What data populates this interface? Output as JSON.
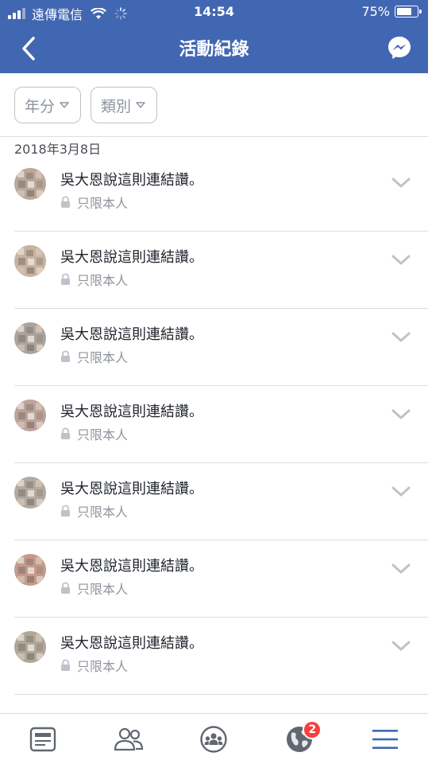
{
  "status_bar": {
    "carrier": "遠傳電信",
    "time": "14:54",
    "battery": "75%",
    "battery_level": 0.75
  },
  "header": {
    "title": "活動紀錄",
    "back_icon": "chevron-left-icon",
    "messenger_icon": "messenger-icon"
  },
  "filters": [
    {
      "label": "年分"
    },
    {
      "label": "類別"
    }
  ],
  "date_header": "2018年3月8日",
  "activities": [
    {
      "text": "吳大恩說這則連結讚。",
      "privacy": "只限本人",
      "avatar_color": "#b9a89b"
    },
    {
      "text": "吳大恩說這則連結讚。",
      "privacy": "只限本人",
      "avatar_color": "#c7b3a2"
    },
    {
      "text": "吳大恩說這則連結讚。",
      "privacy": "只限本人",
      "avatar_color": "#a9a4a0"
    },
    {
      "text": "吳大恩說這則連結讚。",
      "privacy": "只限本人",
      "avatar_color": "#bba39c"
    },
    {
      "text": "吳大恩說這則連結讚。",
      "privacy": "只限本人",
      "avatar_color": "#b0aaa0"
    },
    {
      "text": "吳大恩說這則連結讚。",
      "privacy": "只限本人",
      "avatar_color": "#c49a8c"
    },
    {
      "text": "吳大恩說這則連結讚。",
      "privacy": "只限本人",
      "avatar_color": "#aca99a"
    }
  ],
  "tabbar": {
    "notifications_badge": "2",
    "active_color": "#4267b2",
    "inactive_color": "#606770"
  },
  "colors": {
    "brand_blue": "#4267b2",
    "divider": "#dddfe2",
    "muted_text": "#90949c"
  }
}
